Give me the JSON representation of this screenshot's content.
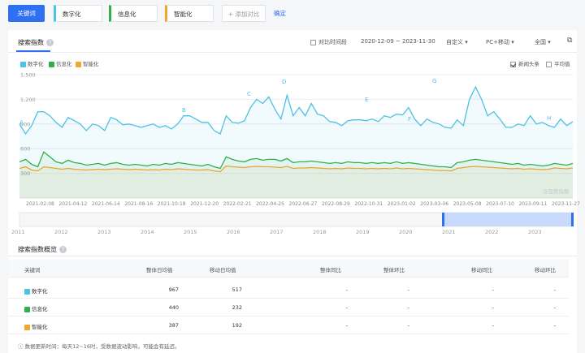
{
  "topbar": {
    "main_keyword": "关键词",
    "keywords": [
      {
        "label": "数字化",
        "color": "#4ec1e6"
      },
      {
        "label": "信息化",
        "color": "#2fb04a"
      },
      {
        "label": "智能化",
        "color": "#f2a630"
      }
    ],
    "add_compare": "+ 添加对比",
    "confirm": "确定"
  },
  "search_index": {
    "title": "搜索指数",
    "compare_period": "对比时间段",
    "date_range": "2020-12-09 ~ 2023-11-30",
    "custom": "自定义",
    "device": "PC+移动",
    "region": "全国",
    "news_headline": "新闻头条",
    "average": "平均值",
    "watermark": "@百度指数"
  },
  "chart_data": {
    "type": "line",
    "yticks": [
      "1,500",
      "1,200",
      "900",
      "600",
      "300"
    ],
    "ylim": [
      0,
      1500
    ],
    "xticks": [
      "2021-02-08",
      "2021-04-12",
      "2021-06-14",
      "2021-08-16",
      "2021-10-18",
      "2021-12-20",
      "2022-02-21",
      "2022-04-25",
      "2022-06-27",
      "2022-08-29",
      "2022-10-31",
      "2023-01-02",
      "2023-03-06",
      "2023-05-08",
      "2023-07-10",
      "2023-09-11",
      "2023-11-27"
    ],
    "annotations": [
      "A",
      "B",
      "C",
      "D",
      "E",
      "F",
      "G",
      "H"
    ],
    "grid": true,
    "series": [
      {
        "name": "数字化",
        "color": "#4ec1e6",
        "values": [
          900,
          780,
          880,
          1050,
          1050,
          1000,
          920,
          860,
          980,
          940,
          900,
          820,
          900,
          880,
          820,
          980,
          950,
          890,
          900,
          880,
          860,
          880,
          900,
          860,
          880,
          840,
          900,
          1000,
          1000,
          960,
          920,
          920,
          820,
          780,
          1000,
          920,
          910,
          940,
          1100,
          1200,
          1150,
          1230,
          1080,
          960,
          1250,
          1000,
          1100,
          1000,
          1150,
          1020,
          1000,
          930,
          920,
          880,
          940,
          950,
          950,
          940,
          960,
          930,
          1000,
          980,
          1020,
          1010,
          1100,
          960,
          880,
          960,
          920,
          900,
          860,
          850,
          950,
          880,
          1200,
          1350,
          1200,
          1000,
          1050,
          960,
          860,
          860,
          900,
          880,
          1000,
          900,
          920,
          880,
          860,
          960,
          880,
          930
        ]
      },
      {
        "name": "信息化",
        "color": "#2fb04a",
        "values": [
          440,
          470,
          410,
          380,
          560,
          500,
          440,
          420,
          460,
          430,
          420,
          400,
          410,
          420,
          400,
          420,
          430,
          410,
          400,
          410,
          400,
          390,
          410,
          400,
          420,
          410,
          430,
          420,
          410,
          400,
          390,
          410,
          380,
          360,
          500,
          470,
          450,
          440,
          470,
          480,
          460,
          470,
          470,
          450,
          480,
          430,
          440,
          440,
          450,
          440,
          430,
          420,
          430,
          420,
          440,
          430,
          430,
          420,
          430,
          420,
          430,
          420,
          440,
          420,
          430,
          420,
          410,
          400,
          390,
          380,
          380,
          370,
          430,
          440,
          460,
          470,
          460,
          450,
          440,
          430,
          420,
          410,
          420,
          400,
          410,
          400,
          390,
          400,
          420,
          410,
          400,
          420
        ]
      },
      {
        "name": "智能化",
        "color": "#f2a630",
        "values": [
          360,
          380,
          340,
          330,
          380,
          370,
          360,
          350,
          360,
          350,
          345,
          340,
          345,
          350,
          345,
          350,
          355,
          350,
          345,
          350,
          345,
          340,
          345,
          340,
          350,
          345,
          355,
          350,
          345,
          340,
          340,
          345,
          330,
          320,
          390,
          380,
          375,
          370,
          380,
          385,
          380,
          380,
          375,
          370,
          385,
          360,
          365,
          365,
          370,
          365,
          360,
          355,
          360,
          355,
          365,
          360,
          360,
          355,
          360,
          355,
          360,
          355,
          365,
          355,
          360,
          355,
          350,
          345,
          340,
          335,
          335,
          330,
          360,
          370,
          380,
          385,
          380,
          375,
          370,
          365,
          360,
          355,
          360,
          350,
          355,
          350,
          345,
          350,
          365,
          360,
          355,
          365
        ]
      }
    ]
  },
  "overview_axis": [
    "2011",
    "2012",
    "2013",
    "2014",
    "2015",
    "2016",
    "2017",
    "2018",
    "2019",
    "2020",
    "2021",
    "2022",
    "2023"
  ],
  "overview": {
    "title": "搜索指数概览",
    "headers": [
      "关键词",
      "整体日均值",
      "移动日均值",
      "整体同比",
      "整体环比",
      "移动同比",
      "移动环比"
    ],
    "rows": [
      {
        "name": "数字化",
        "color": "#4ec1e6",
        "overall": "967",
        "mobile": "517",
        "yoy": "-",
        "mom": "-",
        "myoy": "-",
        "mmom": "-"
      },
      {
        "name": "信息化",
        "color": "#2fb04a",
        "overall": "440",
        "mobile": "232",
        "yoy": "-",
        "mom": "-",
        "myoy": "-",
        "mmom": "-"
      },
      {
        "name": "智能化",
        "color": "#f2a630",
        "overall": "387",
        "mobile": "192",
        "yoy": "-",
        "mom": "-",
        "myoy": "-",
        "mmom": "-"
      }
    ],
    "footnote": "ⓘ 数据更新时间：每天12~16时，受数据波动影响，可能会有延迟。"
  }
}
